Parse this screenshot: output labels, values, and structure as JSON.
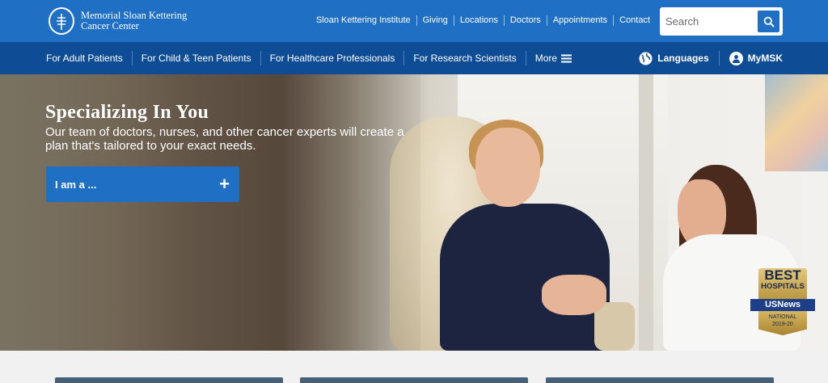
{
  "header": {
    "logo_line1": "Memorial Sloan Kettering",
    "logo_line2": "Cancer Center",
    "utility_links": [
      "Sloan Kettering Institute",
      "Giving",
      "Locations",
      "Doctors",
      "Appointments",
      "Contact"
    ],
    "search_placeholder": "Search",
    "search_icon": "search-icon"
  },
  "nav": {
    "items": [
      "For Adult Patients",
      "For Child & Teen Patients",
      "For Healthcare Professionals",
      "For Research Scientists"
    ],
    "more_label": "More",
    "more_icon": "hamburger-icon",
    "languages_label": "Languages",
    "languages_icon": "globe-icon",
    "mymsk_label": "MyMSK",
    "mymsk_icon": "user-icon"
  },
  "hero": {
    "title": "Specializing In You",
    "subtitle": "Our team of doctors, nurses, and other cancer experts will create a plan that's tailored to your exact needs.",
    "iam_label": "I am a ...",
    "iam_icon": "+",
    "badge": {
      "line1": "BEST",
      "line2": "HOSPITALS",
      "ribbon": "USNews",
      "line3": "NATIONAL",
      "line4": "2019-20"
    }
  },
  "colors": {
    "primary": "#1f6fc4",
    "nav": "#0e4d96"
  }
}
